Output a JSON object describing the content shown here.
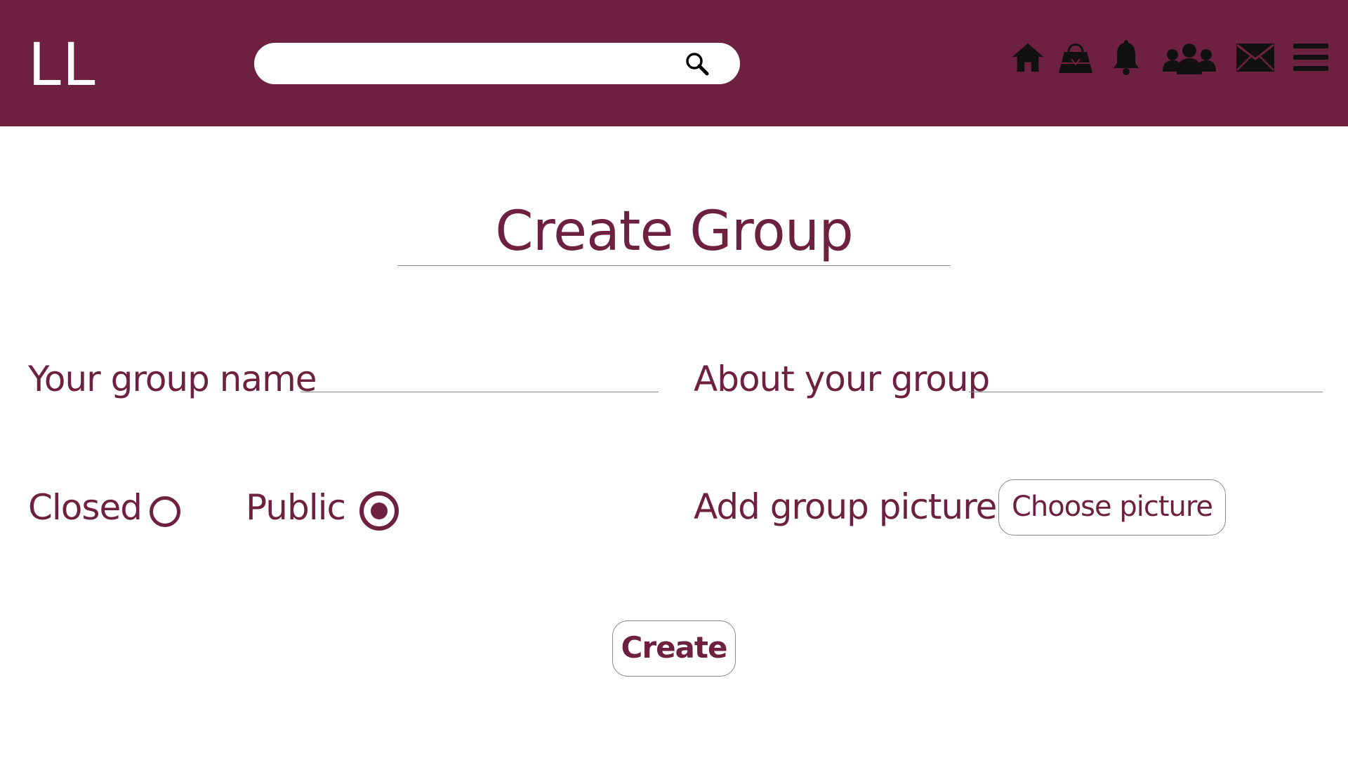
{
  "header": {
    "logo": "LL",
    "search": {
      "placeholder": "",
      "value": ""
    },
    "nav_icons": [
      "home-icon",
      "handbag-icon",
      "bell-icon",
      "group-icon",
      "mail-icon",
      "menu-icon"
    ]
  },
  "page": {
    "title": "Create Group"
  },
  "form": {
    "group_name_label": "Your group name",
    "group_name_value": "",
    "about_label": "About your group",
    "about_value": "",
    "visibility": {
      "closed_label": "Closed",
      "public_label": "Public",
      "selected": "Public"
    },
    "picture_label": "Add group picture",
    "choose_picture_label": "Choose picture",
    "create_label": "Create"
  },
  "colors": {
    "brand": "#6e213e",
    "background": "#ffffff",
    "divider": "#8a8a8a",
    "icon": "#111111"
  }
}
